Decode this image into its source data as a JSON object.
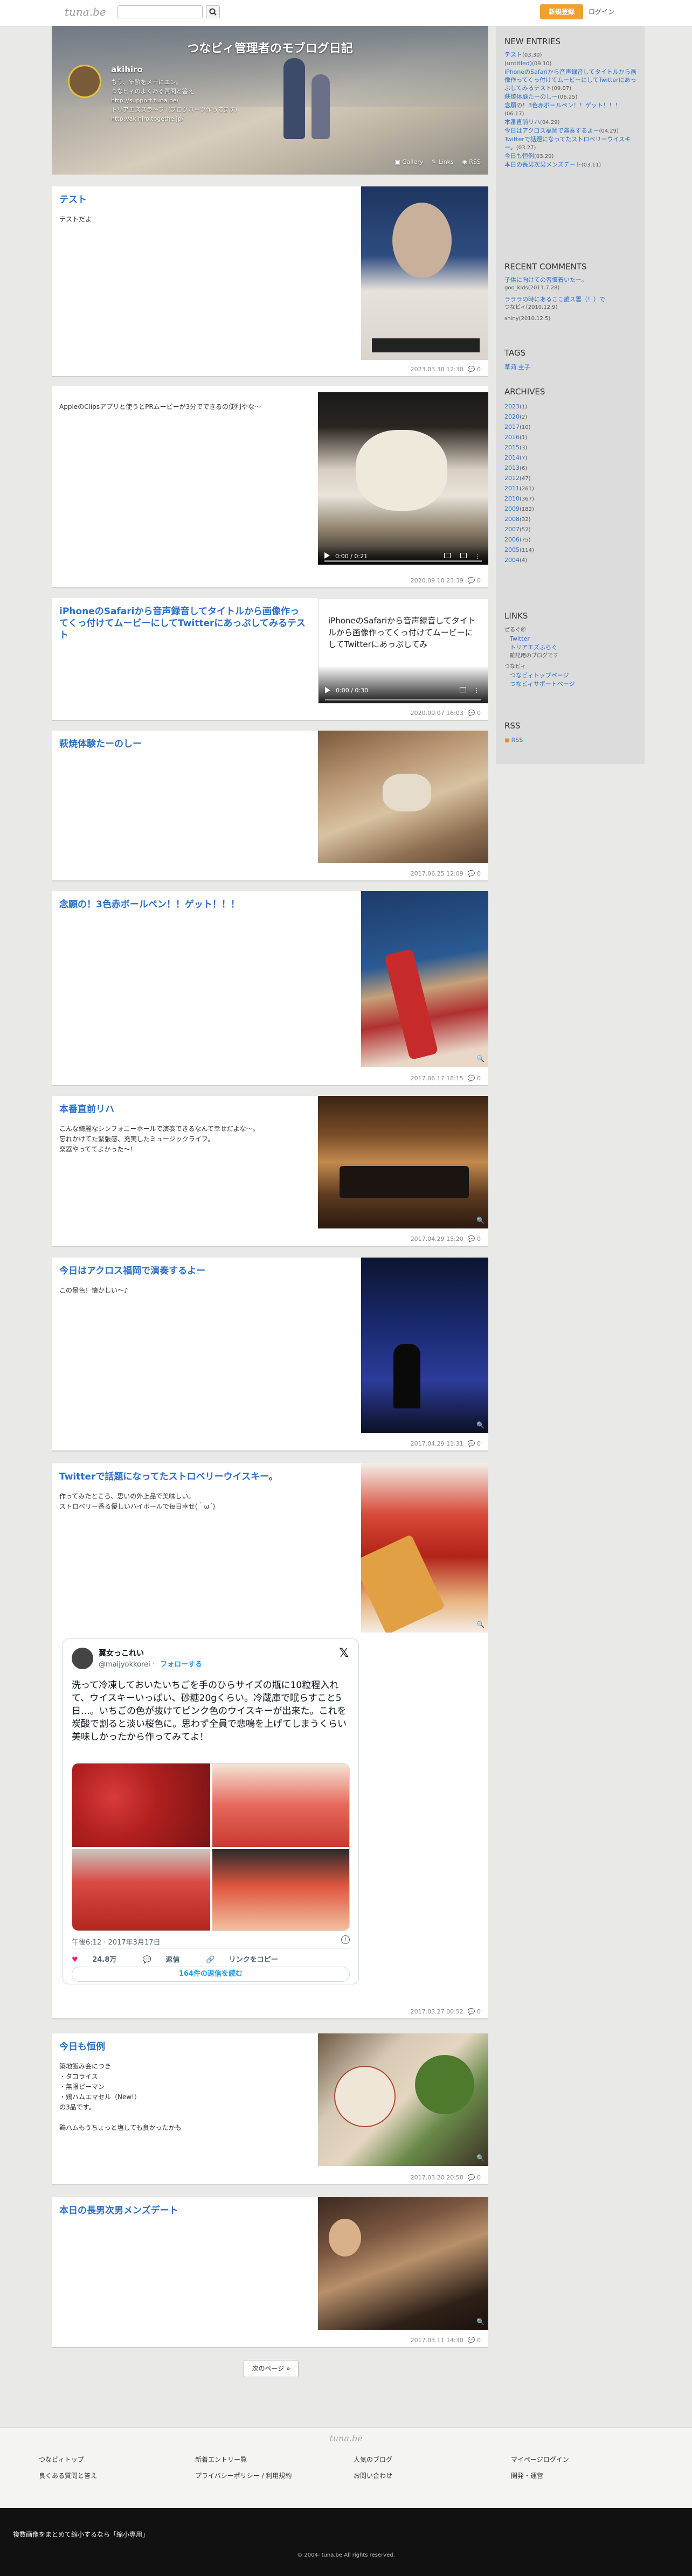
{
  "topbar": {
    "logo": "tuna.be",
    "search_placeholder": "",
    "signup": "新規登録",
    "login": "ログイン"
  },
  "header": {
    "blog_title": "つなビィ管理者のモブログ日記",
    "author_name": "akihiro",
    "author_bio": "もう、年齢をメモにエン。\nつなビィのよくある質問と答え",
    "author_url1": "http://support.tuna.be/",
    "author_bio2": "トリアエズスラ〜プ（ブログパーツ作ってます）",
    "author_url2": "http://akihiro.togethe.jp/",
    "nav": [
      "Gallery",
      "Links",
      "RSS"
    ]
  },
  "posts": [
    {
      "title": "テスト",
      "body": "テストだよ",
      "date": "2023.03.30 12:30",
      "comments": "0"
    },
    {
      "title": "",
      "body": "AppleのClipsアプリと使うとPRムービーが3分でできるの便利やな〜",
      "date": "2020.09.10 23:39",
      "comments": "0",
      "video_time": "0:00 / 0:21"
    },
    {
      "title": "iPhoneのSafariから音声録音してタイトルから画像作ってくっ付けてムービーにしてTwitterにあっぷしてみるテスト",
      "body": "",
      "date": "2020.09.07 16:03",
      "comments": "0",
      "video_caption": "iPhoneのSafariから音声録音してタイトルから画像作ってくっ付けてムービーにしてTwitterにあっぷしてみ",
      "video_time": "0:00 / 0:30"
    },
    {
      "title": "萩焼体験たーのしー",
      "body": "",
      "date": "2017.06.25 12:09",
      "comments": "0"
    },
    {
      "title": "念願の！3色赤ボールペン！！ゲット！！！",
      "body": "",
      "date": "2017.06.17 18:15",
      "comments": "0"
    },
    {
      "title": "本番直前リハ",
      "body": "こんな綺麗なシンフォニーホールで演奏できるなんて幸せだよな〜。\n忘れかけてた緊張感、充実したミュージックライフ。\n楽器やっててよかった〜！",
      "date": "2017.04.29 13:20",
      "comments": "0"
    },
    {
      "title": "今日はアクロス福岡で演奏するよー",
      "body": "この景色！懐かしい〜♪",
      "date": "2017.04.29 11:31",
      "comments": "0"
    },
    {
      "title": "Twitterで話題になってたストロベリーウイスキー。",
      "body": "作ってみたところ、思いの外上品で美味しい。\nストロベリー香る優しいハイボールで毎日幸せ(｀ω´)",
      "date": "2017.03.27 00:52",
      "comments": "0"
    },
    {
      "title": "今日も恒例",
      "body": "築地飯み会につき\n・タコライス\n・無限ピーマン\n・鶏ハムエマセル（New!）\nの3品です。\n\n鶏ハムもうちょっと塩しても良かったかも",
      "date": "2017.03.20 20:58",
      "comments": "0"
    },
    {
      "title": "本日の長男次男メンズデート",
      "body": "",
      "date": "2017.03.11 14:30",
      "comments": "0"
    }
  ],
  "tweet": {
    "name": "翼女っこれい",
    "handle": "@maijyokkorei",
    "follow": "フォローする",
    "x_icon": "𝕏",
    "text": "洗って冷凍しておいたいちごを手のひらサイズの瓶に10粒程入れて、ウイスキーいっぱい、砂糖20gくらい。冷蔵庫で眠らすこと5日…。いちごの色が抜けてピンク色のウイスキーが出来た。これを炭酸で割ると淡い桜色に。思わず全員で悲鳴を上げてしまうくらい美味しかったから作ってみてよ！",
    "time": "午後6:12 · 2017年3月17日",
    "likes": "24.8万",
    "reply": "返信",
    "copy_link": "リンクをコピー",
    "read_replies": "164件の返信を読む"
  },
  "next_page": "次のページ »",
  "sidebar": {
    "new_entries_title": "NEW ENTRIES",
    "new_entries": [
      {
        "title": "テスト",
        "date": "(03.30)"
      },
      {
        "title": "(untitled)",
        "date": "(09.10)"
      },
      {
        "title": "iPhoneのSafariから音声録音してタイトルから画像作ってくっ付けてムービーにしてTwitterにあっぷしてみるテスト",
        "date": "(09.07)"
      },
      {
        "title": "萩焼体験たーのしー",
        "date": "(06.25)"
      },
      {
        "title": "念願の！3色赤ボールペン！！ゲット！！！",
        "date": "(06.17)"
      },
      {
        "title": "本番直前リハ",
        "date": "(04.29)"
      },
      {
        "title": "今日はアクロス福岡で演奏するよー",
        "date": "(04.29)"
      },
      {
        "title": "Twitterで話題になってたストロベリーウイスキー。",
        "date": "(03.27)"
      },
      {
        "title": "今日も恒例",
        "date": "(03.20)"
      },
      {
        "title": "本日の長男次男メンズデート",
        "date": "(03.11)"
      }
    ],
    "recent_comments_title": "RECENT COMMENTS",
    "recent_comments": [
      {
        "title": "子供に向けての習慣着いたー。",
        "by": "goo_kids(2011.7.28)"
      },
      {
        "title": "ラララの時にあるここ誰ス雲（！）で",
        "by": "つなビィ(2010.12.9)"
      },
      {
        "title": "",
        "by": "shiny(2010.12.5)"
      }
    ],
    "tags_title": "TAGS",
    "tags": [
      "草苅 圭子"
    ],
    "archives_title": "ARCHIVES",
    "archives": [
      {
        "year": "2023",
        "count": "(1)"
      },
      {
        "year": "2020",
        "count": "(2)"
      },
      {
        "year": "2017",
        "count": "(10)"
      },
      {
        "year": "2016",
        "count": "(1)"
      },
      {
        "year": "2015",
        "count": "(3)"
      },
      {
        "year": "2014",
        "count": "(7)"
      },
      {
        "year": "2013",
        "count": "(6)"
      },
      {
        "year": "2012",
        "count": "(47)"
      },
      {
        "year": "2011",
        "count": "(261)"
      },
      {
        "year": "2010",
        "count": "(367)"
      },
      {
        "year": "2009",
        "count": "(182)"
      },
      {
        "year": "2008",
        "count": "(32)"
      },
      {
        "year": "2007",
        "count": "(52)"
      },
      {
        "year": "2006",
        "count": "(75)"
      },
      {
        "year": "2005",
        "count": "(114)"
      },
      {
        "year": "2004",
        "count": "(4)"
      }
    ],
    "links_title": "LINKS",
    "links_group1": "ぜるぐ＠",
    "links": [
      "Twitter",
      "トリアエズふらぐ"
    ],
    "links_note": "雑記用のブログです",
    "links_group2": "つなビィ",
    "links2": [
      "つなビィトップページ",
      "つなビィサポートページ"
    ],
    "rss_title": "RSS",
    "rss_link": "RSS"
  },
  "footer": {
    "logo": "tuna.be",
    "col1": [
      "つなビィトップ",
      "良くある質問と答え"
    ],
    "col2": [
      "新着エントリー覧",
      "プライバシーポリシー / 利用規約"
    ],
    "col3": [
      "人気のブログ",
      "お問い合わせ"
    ],
    "col4": [
      "マイページログイン",
      "開発・運営"
    ],
    "notice": "複数画像をまとめて縮小するなら「縮小専用」",
    "copyright": "© 2004- tuna.be All rights reserved."
  },
  "colors": {
    "accent": "#2a6fc9",
    "signup": "#f0a030"
  }
}
